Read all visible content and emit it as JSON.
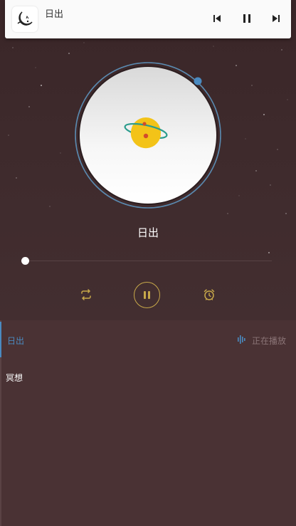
{
  "notification": {
    "title": "日出",
    "icon": "moon-cat-app-icon",
    "controls": [
      "skip-previous-icon",
      "pause-icon",
      "skip-next-icon"
    ]
  },
  "player": {
    "song_title": "日出",
    "progress": 0.0,
    "controls": {
      "repeat": "repeat-icon",
      "play_pause": "pause-icon",
      "alarm": "alarm-clock-icon"
    }
  },
  "playlist": {
    "items": [
      {
        "label": "日出",
        "status": "正在播放",
        "active": true
      },
      {
        "label": "冥想",
        "status": "",
        "active": false
      }
    ]
  },
  "colors": {
    "background": "#3e2a2c",
    "playlist_bg": "#4a3234",
    "accent_gold": "#c8a94a",
    "accent_blue": "#4a8ac0",
    "disc_ring": "#5a8ab0",
    "planet": "#f3c318",
    "planet_ring": "#2a9c8c"
  }
}
